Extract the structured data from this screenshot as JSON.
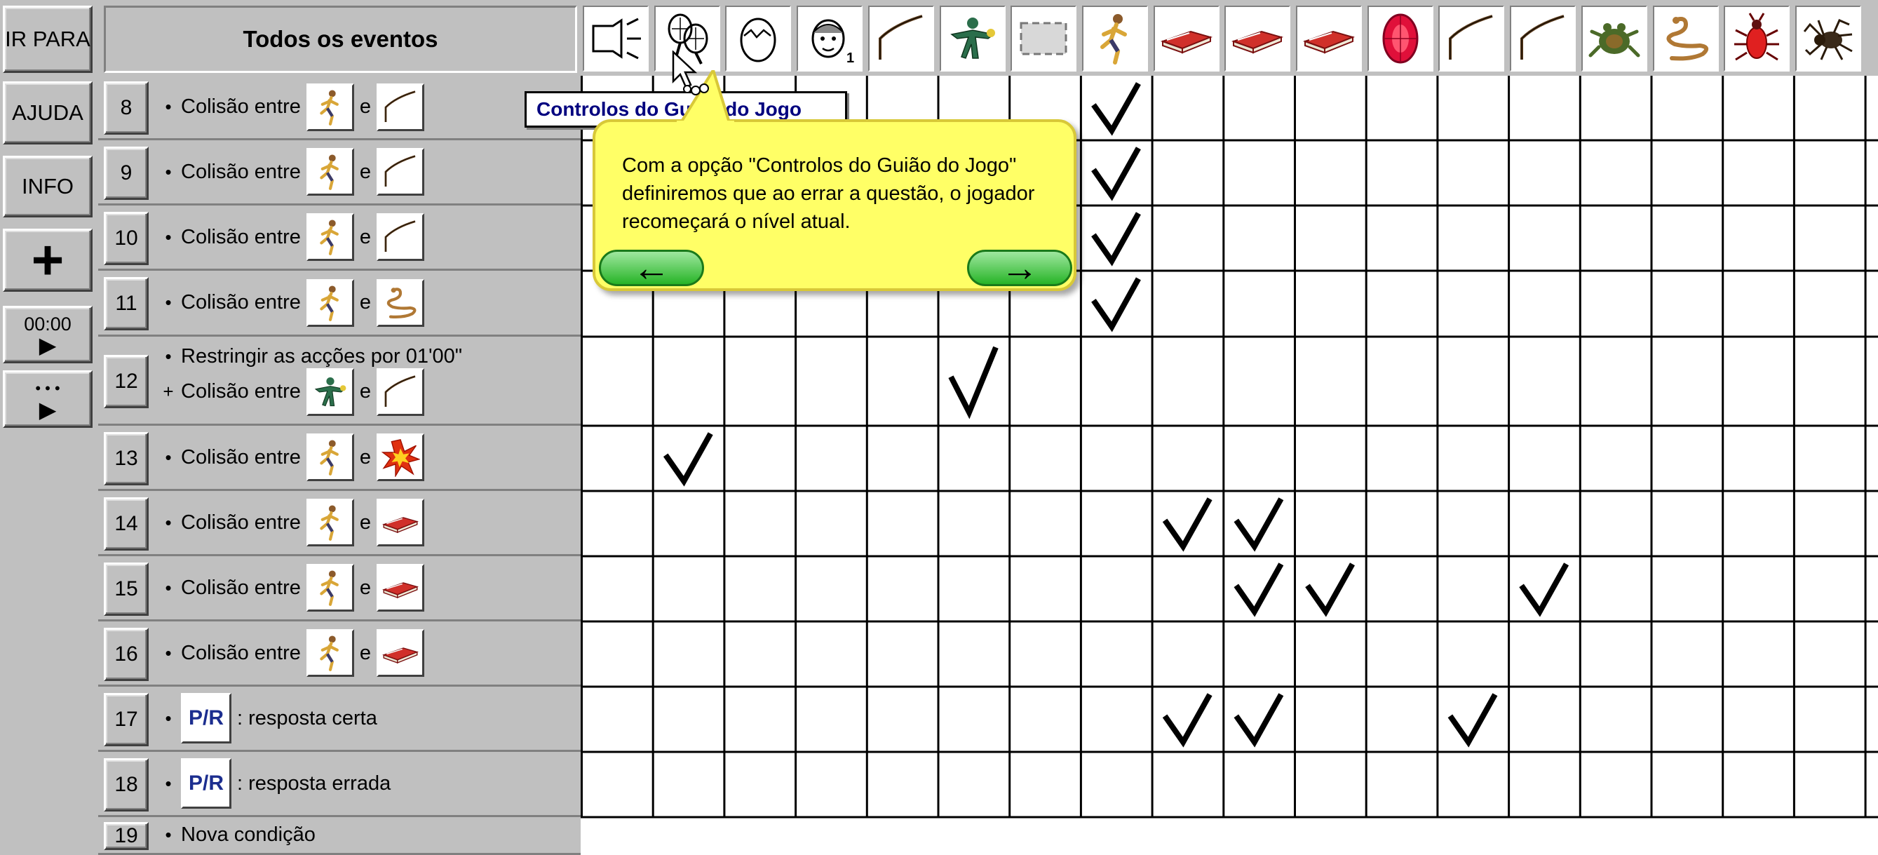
{
  "window": {
    "title": "Todos os eventos"
  },
  "left_panel": {
    "goto_label": "IR PARA",
    "help_label": "AJUDA",
    "info_label": "INFO",
    "add_label": "+",
    "timer_label": "00:00",
    "play_symbol": "▶",
    "more_symbol": "• • •"
  },
  "header_icons": [
    "lamp-icon",
    "tennis-rackets-icon",
    "egg-icon",
    "head-icon",
    "stick-icon",
    "green-man-icon",
    "frame-icon",
    "running-man-icon",
    "red-book-icon",
    "red-book-icon",
    "red-book-icon",
    "ruby-icon",
    "stick-icon",
    "stick-icon",
    "frog-icon",
    "snake-icon",
    "bug-icon",
    "spider-icon"
  ],
  "head_icon_sub": "1",
  "rows": [
    {
      "num": "8",
      "lines": [
        {
          "prefix": "•",
          "text": "Colisão entre",
          "a": "running-man-icon",
          "conj": "e",
          "b": "stick-icon"
        }
      ]
    },
    {
      "num": "9",
      "lines": [
        {
          "prefix": "•",
          "text": "Colisão entre",
          "a": "running-man-icon",
          "conj": "e",
          "b": "stick-icon"
        }
      ]
    },
    {
      "num": "10",
      "lines": [
        {
          "prefix": "•",
          "text": "Colisão entre",
          "a": "running-man-icon",
          "conj": "e",
          "b": "stick-icon"
        }
      ]
    },
    {
      "num": "11",
      "lines": [
        {
          "prefix": "•",
          "text": "Colisão entre",
          "a": "running-man-icon",
          "conj": "e",
          "b": "snake-icon"
        }
      ]
    },
    {
      "num": "12",
      "lines": [
        {
          "prefix": "•",
          "text": "Restringir as acções por 01'00\""
        },
        {
          "prefix": "+",
          "text": "Colisão entre",
          "a": "green-man-icon",
          "conj": "e",
          "b": "stick-icon"
        }
      ]
    },
    {
      "num": "13",
      "lines": [
        {
          "prefix": "•",
          "text": "Colisão entre",
          "a": "running-man-icon",
          "conj": "e",
          "b": "explosion-icon"
        }
      ]
    },
    {
      "num": "14",
      "lines": [
        {
          "prefix": "•",
          "text": "Colisão entre",
          "a": "running-man-icon",
          "conj": "e",
          "b": "red-book-icon"
        }
      ]
    },
    {
      "num": "15",
      "lines": [
        {
          "prefix": "•",
          "text": "Colisão entre",
          "a": "running-man-icon",
          "conj": "e",
          "b": "red-book-icon"
        }
      ]
    },
    {
      "num": "16",
      "lines": [
        {
          "prefix": "•",
          "text": "Colisão entre",
          "a": "running-man-icon",
          "conj": "e",
          "b": "red-book-icon"
        }
      ]
    },
    {
      "num": "17",
      "lines": [
        {
          "prefix": "•",
          "pr": "P/R",
          "text": ": resposta certa"
        }
      ]
    },
    {
      "num": "18",
      "lines": [
        {
          "prefix": "•",
          "pr": "P/R",
          "text": ": resposta errada"
        }
      ]
    },
    {
      "num": "19",
      "lines": [
        {
          "prefix": "•",
          "text": "Nova condição"
        }
      ]
    }
  ],
  "checks": [
    [
      0,
      7
    ],
    [
      1,
      7
    ],
    [
      2,
      7
    ],
    [
      3,
      7
    ],
    [
      4,
      5
    ],
    [
      5,
      1
    ],
    [
      6,
      8
    ],
    [
      6,
      9
    ],
    [
      7,
      9
    ],
    [
      7,
      10
    ],
    [
      7,
      13
    ],
    [
      9,
      8
    ],
    [
      9,
      9
    ],
    [
      9,
      12
    ]
  ],
  "tooltip": {
    "tag": "Controlos do Guião do Jogo",
    "balloon": "Com a opção \"Controlos do Guião do Jogo\" definiremos que ao errar a questão, o jogador recomeçará o nível atual.",
    "prev": "←",
    "next": "→"
  },
  "colors": {
    "check": "#000000",
    "balloon": "#ffff66",
    "nav": "#33bb33"
  }
}
